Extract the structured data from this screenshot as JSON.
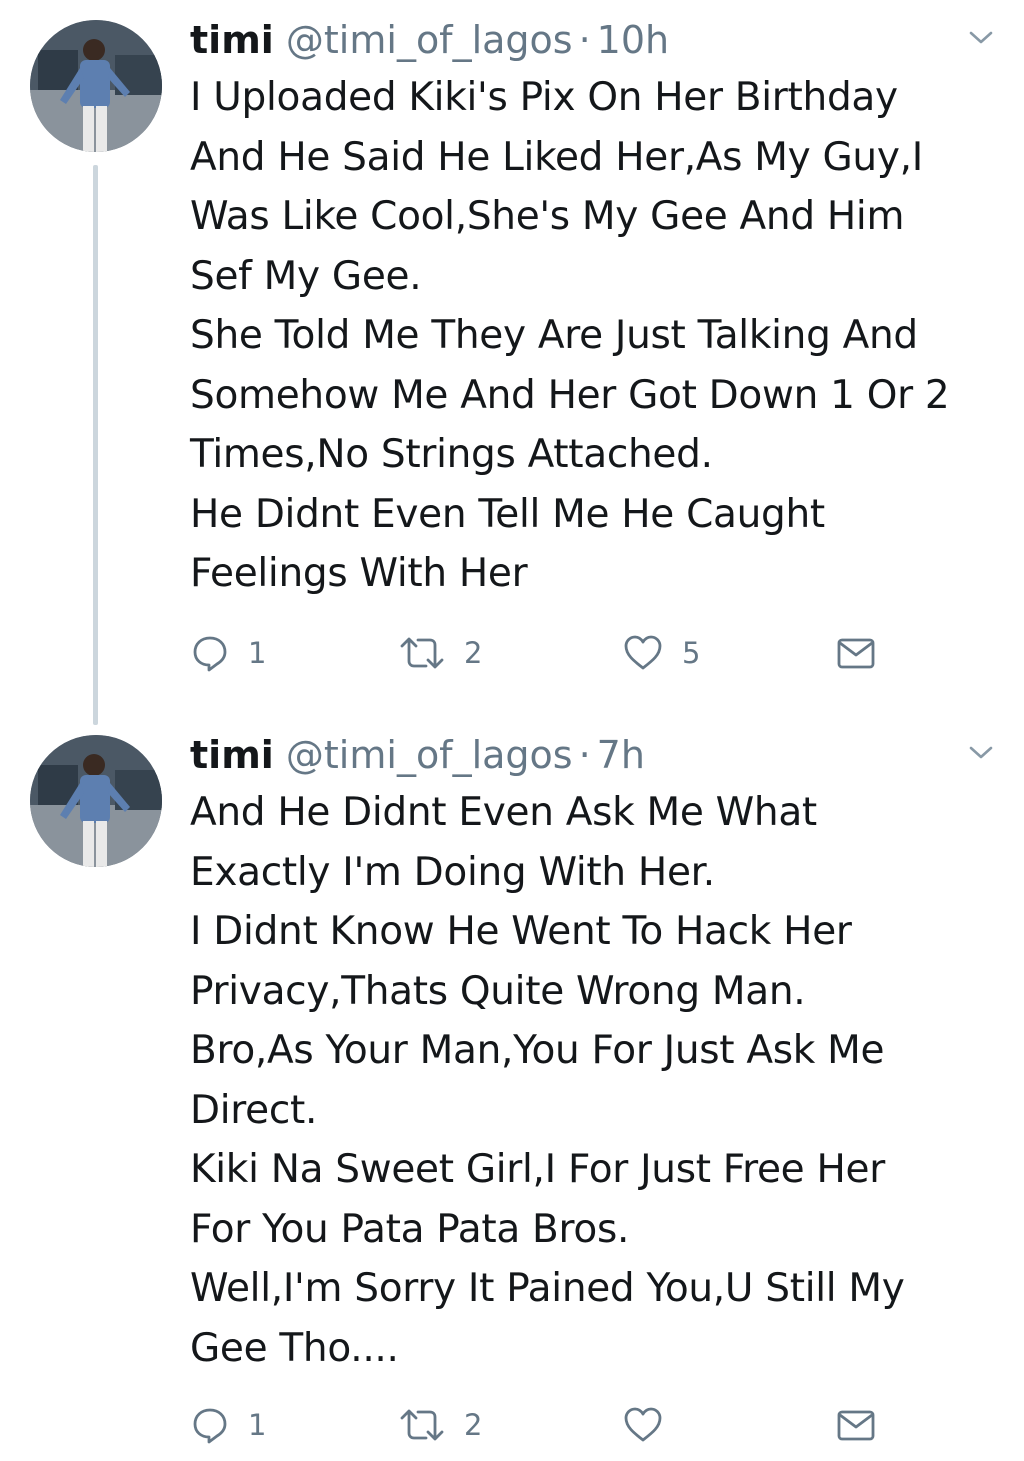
{
  "tweets": [
    {
      "name": "timi",
      "handle": "@timi_of_lagos",
      "separator": "·",
      "time": "10h",
      "text": "I Uploaded Kiki's Pix On Her Birthday\nAnd He Said He Liked Her,As My Guy,I\nWas Like Cool,She's My Gee And Him\nSef My Gee.\nShe Told Me They Are Just Talking And\nSomehow Me And Her Got Down 1 Or 2\nTimes,No Strings Attached.\nHe Didnt Even Tell Me He Caught\nFeelings With Her",
      "replies": "1",
      "retweets": "2",
      "likes": "5"
    },
    {
      "name": "timi",
      "handle": "@timi_of_lagos",
      "separator": "·",
      "time": "7h",
      "text": "And He Didnt Even Ask Me What\nExactly I'm Doing With Her.\nI Didnt Know He Went To Hack Her\nPrivacy,Thats Quite Wrong Man.\nBro,As Your Man,You For Just Ask Me\nDirect.\nKiki Na Sweet Girl,I For Just Free Her\nFor You Pata Pata Bros.\nWell,I'm Sorry It Pained You,U Still My\nGee Tho....",
      "replies": "1",
      "retweets": "2",
      "likes": ""
    }
  ],
  "icons": {
    "reply": "reply-icon",
    "retweet": "retweet-icon",
    "like": "heart-icon",
    "dm": "envelope-icon",
    "menu": "chevron-down-icon"
  },
  "colors": {
    "text": "#14171a",
    "secondary": "#657786",
    "thread_line": "#ccd6dd"
  }
}
